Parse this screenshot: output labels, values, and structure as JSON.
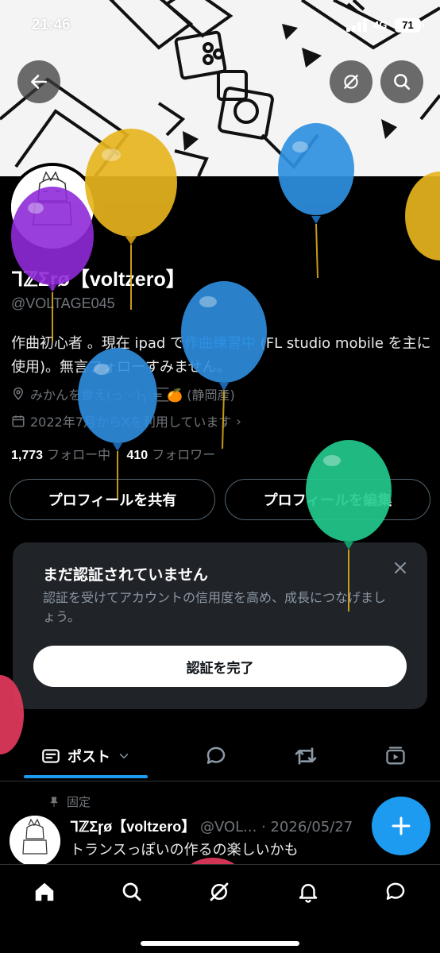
{
  "status": {
    "time": "21:46",
    "network": "4G",
    "battery": "71"
  },
  "profile": {
    "name": "ᒣℤΣɼø【voltzero】",
    "handle": "@VOLTAGE045",
    "bio_part1": "作曲初心者 。現在 ipad で",
    "bio_link": "作曲練習中",
    "bio_part2": " (FL studio mobile を主に使用)。無言フォローすみません。",
    "location": "みかんを食え(っ'-')╮ =͟͟͞͞ 🍊 (静岡産)",
    "joined": "2022年7月からXを利用しています",
    "joined_chevron": "›",
    "following_count": "1,773",
    "following_label": "フォロー中",
    "followers_count": "410",
    "followers_label": "フォロワー",
    "share_label": "プロフィールを共有",
    "edit_label": "プロフィールを編集"
  },
  "verify": {
    "title": "まだ認証されていません",
    "text": "認証を受けてアカウントの信用度を高め、成長につなげましょう。",
    "button": "認証を完了"
  },
  "tabs": {
    "posts": "ポスト"
  },
  "post": {
    "pinned_label": "固定",
    "name": "ᒣℤΣɼø【voltzero】",
    "meta": "@VOL... · 2026/05/27",
    "text": "トランスっぽいの作るの楽しいかも"
  },
  "colors": {
    "accent": "#1d9bf0",
    "background": "#000000",
    "card": "#202327"
  },
  "icons": [
    "back-arrow-icon",
    "grok-icon",
    "search-icon",
    "location-icon",
    "calendar-icon",
    "close-icon",
    "posts-icon",
    "chevron-down-icon",
    "reply-icon",
    "repost-icon",
    "media-icon",
    "pin-icon",
    "plus-icon",
    "home-icon",
    "notifications-icon",
    "messages-icon"
  ]
}
